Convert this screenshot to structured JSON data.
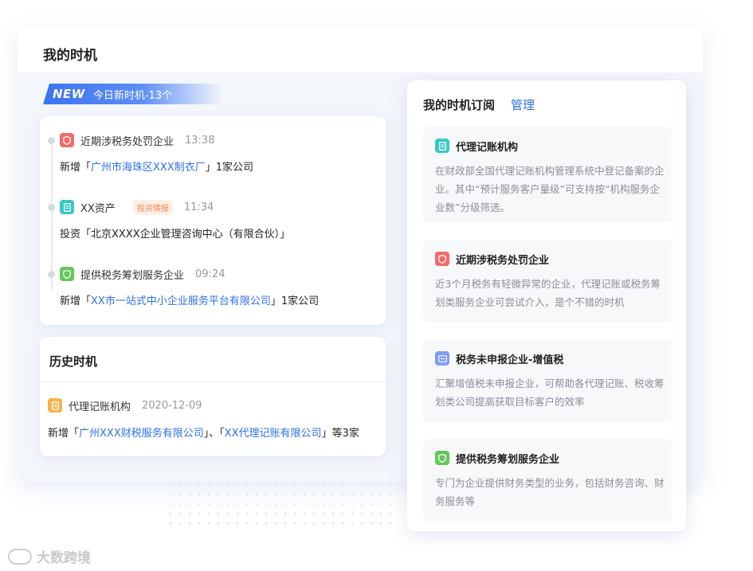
{
  "page_title": "我的时机",
  "new_banner": {
    "tag": "NEW",
    "label": "今日新时机-13个"
  },
  "today_items": [
    {
      "name": "近期涉税务处罚企业",
      "time": "13:38",
      "badge": "",
      "detail_prefix": "新增「",
      "detail_link": "广州市海珠区XXX制衣厂",
      "detail_suffix": "」1家公司",
      "icon": "shield-icon",
      "color": "#f36a6a"
    },
    {
      "name": "XX资产",
      "time": "11:34",
      "badge": "投资情报",
      "detail_prefix": "投资「北京XXXX企业管理咨询中心（有限合伙）」",
      "detail_link": "",
      "detail_suffix": "",
      "icon": "document-icon",
      "color": "#38c8c2"
    },
    {
      "name": "提供税务筹划服务企业",
      "time": "09:24",
      "badge": "",
      "detail_prefix": "新增「",
      "detail_link": "XX市一站式中小企业服务平台有限公司",
      "detail_suffix": "」1家公司",
      "icon": "shield-icon",
      "color": "#64c75b"
    }
  ],
  "history": {
    "title": "历史时机",
    "item_name": "代理记账机构",
    "item_date": "2020-12-09",
    "detail_prefix": "新增「",
    "detail_link1": "广州XXX财税服务有限公司",
    "detail_mid": "」、「",
    "detail_link2": "XX代理记账有限公司",
    "detail_suffix": "」等3家",
    "icon": "receipt-icon",
    "color": "#f7b24a"
  },
  "subscriptions": {
    "title": "我的时机订阅",
    "manage_label": "管理",
    "items": [
      {
        "name": "代理记账机构",
        "desc": "在财政部全国代理记账机构管理系统中登记备案的企业。其中“预计服务客户量级”可支持按“机构服务企业数”分级筛选。",
        "icon": "document-icon",
        "color": "#38c8c2"
      },
      {
        "name": "近期涉税务处罚企业",
        "desc": "近3个月税务有轻微异常的企业，代理记账或税务筹划类服务企业可尝试介入，是个不错的时机",
        "icon": "shield-icon",
        "color": "#f36a6a"
      },
      {
        "name": "税务未申报企业-增值税",
        "desc": "汇聚增值税未申报企业，可帮助各代理记账、税收筹划类公司提高获取目标客户的效率",
        "icon": "tax-icon",
        "color": "#7f9cf6"
      },
      {
        "name": "提供税务筹划服务企业",
        "desc": "专门为企业提供财务类型的业务，包括财务咨询、财务服务等",
        "icon": "shield-icon",
        "color": "#64c75b"
      }
    ]
  },
  "watermark": "大数跨境"
}
